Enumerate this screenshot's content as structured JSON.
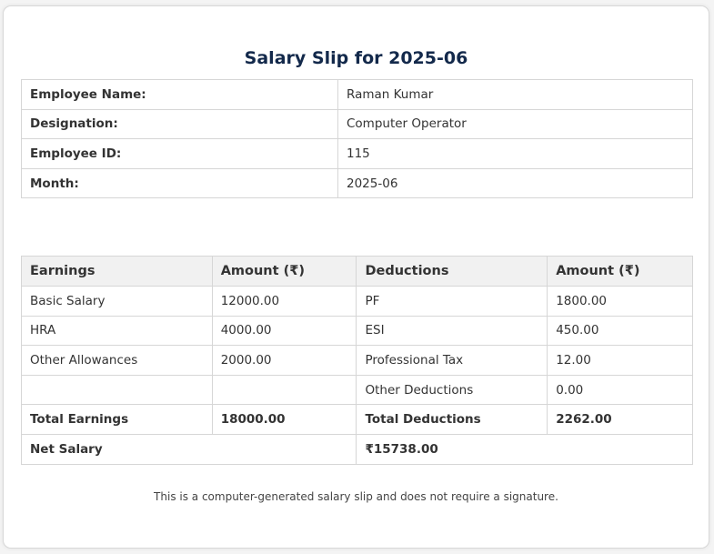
{
  "title": "Salary Slip for 2025-06",
  "employee": [
    {
      "label": "Employee Name:",
      "value": "Raman Kumar"
    },
    {
      "label": "Designation:",
      "value": "Computer Operator"
    },
    {
      "label": "Employee ID:",
      "value": "115"
    },
    {
      "label": "Month:",
      "value": "2025-06"
    }
  ],
  "salary": {
    "headers": [
      "Earnings",
      "Amount (₹)",
      "Deductions",
      "Amount (₹)"
    ],
    "rows": [
      [
        "Basic Salary",
        "12000.00",
        "PF",
        "1800.00"
      ],
      [
        "HRA",
        "4000.00",
        "ESI",
        "450.00"
      ],
      [
        "Other Allowances",
        "2000.00",
        "Professional Tax",
        "12.00"
      ],
      [
        "",
        "",
        "Other Deductions",
        "0.00"
      ]
    ],
    "total_earnings_label": "Total Earnings",
    "total_earnings": "18000.00",
    "total_deductions_label": "Total Deductions",
    "total_deductions": "2262.00",
    "net_salary_label": "Net Salary",
    "net_salary": "₹15738.00"
  },
  "footer": "This is a computer-generated salary slip and does not require a signature."
}
